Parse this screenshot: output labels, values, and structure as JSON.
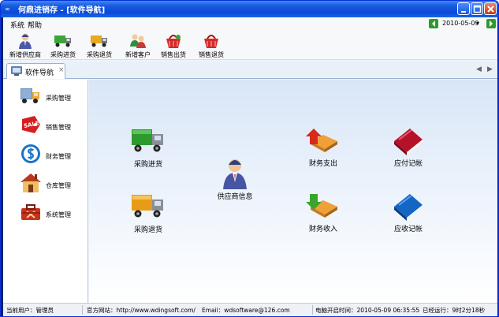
{
  "window": {
    "title": "何鼎进销存 - [软件导航]",
    "app_icon": "∞"
  },
  "menubar": {
    "items": [
      "系统",
      "帮助"
    ],
    "date": "2010-05-09",
    "date_dropdown": "▾",
    "prev_icon": "prev-green-arrow-icon",
    "next_icon": "next-green-arrow-icon"
  },
  "toolbar": {
    "items": [
      {
        "label": "新增供应商",
        "icon": "supplier-person-icon"
      },
      {
        "label": "采购进货",
        "icon": "green-truck-icon"
      },
      {
        "label": "采购退货",
        "icon": "yellow-truck-icon"
      },
      {
        "label": "新增客户",
        "icon": "customers-icon"
      },
      {
        "label": "销售出货",
        "icon": "red-basket-icon"
      },
      {
        "label": "销售退货",
        "icon": "red-basket-return-icon"
      }
    ]
  },
  "tabs": {
    "active": {
      "label": "软件导航",
      "close": "×",
      "icon": "navigation-icon"
    },
    "left_arrow": "◀",
    "right_arrow": "▶"
  },
  "sidebar": {
    "items": [
      {
        "label": "采购管理",
        "icon": "purchase-truck-icon"
      },
      {
        "label": "销售管理",
        "icon": "sale-tag-icon"
      },
      {
        "label": "财务管理",
        "icon": "finance-dollar-icon"
      },
      {
        "label": "仓库管理",
        "icon": "warehouse-house-icon"
      },
      {
        "label": "系统管理",
        "icon": "toolbox-icon"
      }
    ]
  },
  "main": {
    "functions": [
      {
        "label": "采购进货",
        "icon": "green-truck-icon"
      },
      {
        "label": "采购退货",
        "icon": "yellow-truck-icon"
      },
      {
        "label": "供应商信息",
        "icon": "supplier-person-icon"
      },
      {
        "label": "财务支出",
        "icon": "finance-out-icon"
      },
      {
        "label": "财务收入",
        "icon": "finance-in-icon"
      },
      {
        "label": "应付记帐",
        "icon": "red-book-icon"
      },
      {
        "label": "应收记帐",
        "icon": "blue-book-icon"
      }
    ]
  },
  "statusbar": {
    "user": "当前用户：管理员",
    "site": "官方网站：http://www.wdingsoft.com/",
    "email": "Email：wdsoftware@126.com",
    "start_time": "电脑开启时间：2010-05-09 06:35:55",
    "uptime": "已经运行：9时2分18秒"
  },
  "colors": {
    "titlebar": "#0a4ad8",
    "main_bg": "#d9e6f7",
    "green_button": "#2e9a2e"
  }
}
